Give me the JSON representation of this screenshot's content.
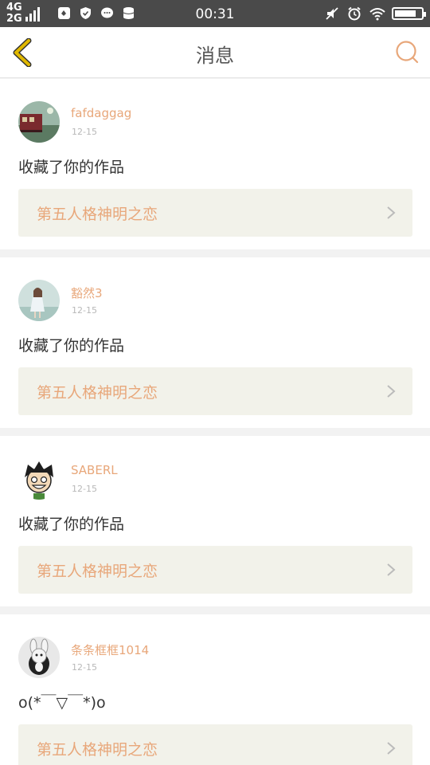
{
  "status_bar": {
    "network_top": "4G",
    "network_bottom": "2G",
    "time": "00:31"
  },
  "header": {
    "title": "消息"
  },
  "notifications": [
    {
      "username": "fafdaggag",
      "date": "12-15",
      "message": "收藏了你的作品",
      "work_title": "第五人格神明之恋"
    },
    {
      "username": "豁然3",
      "date": "12-15",
      "message": "收藏了你的作品",
      "work_title": "第五人格神明之恋"
    },
    {
      "username": "SABERL",
      "date": "12-15",
      "message": "收藏了你的作品",
      "work_title": "第五人格神明之恋"
    },
    {
      "username": "条条框框1014",
      "date": "12-15",
      "message": "o(*￣▽￣*)o",
      "work_title": "第五人格神明之恋"
    }
  ],
  "colors": {
    "accent": "#e8a77a",
    "back_arrow": "#e0b800",
    "status_bar_bg": "#4a4a4a",
    "link_bg": "#f2f2ea"
  }
}
